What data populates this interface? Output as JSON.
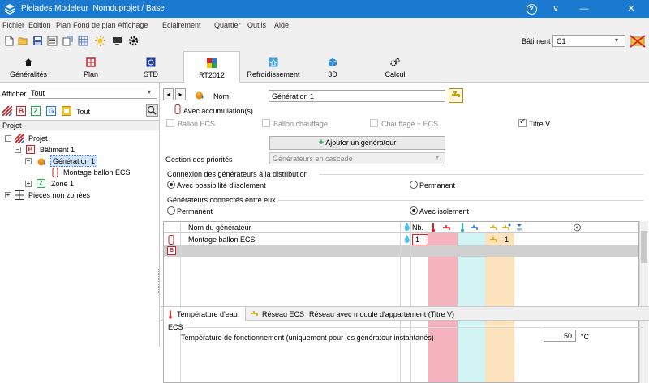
{
  "titlebar": {
    "app_name": "Pleiades Modeleur",
    "project_path": "Nomduprojet / Base",
    "help_glyph": "?",
    "chevron_glyph": "∨",
    "minimize_glyph": "—",
    "close_glyph": "✕"
  },
  "menu": [
    "Fichier",
    "Edition",
    "Plan",
    "Fond de plan",
    "Affichage",
    "Eclairement",
    "Quartier",
    "Outils",
    "Aide"
  ],
  "toolbar": {
    "icons": [
      "new-icon",
      "open-icon",
      "save-icon",
      "list-icon",
      "export-icon",
      "grid-icon",
      "sun-icon",
      "monitor-icon",
      "gear-icon"
    ],
    "batiment_label": "Bâtiment",
    "batiment_value": "C1"
  },
  "tabs": [
    {
      "label": "Généralités",
      "icon": "home-icon"
    },
    {
      "label": "Plan",
      "icon": "plan-icon"
    },
    {
      "label": "STD",
      "icon": "std-icon"
    },
    {
      "label": "RT2012",
      "icon": "rt2012-icon"
    },
    {
      "label": "Refroidissement",
      "icon": "refroidissement-icon"
    },
    {
      "label": "3D",
      "icon": "cube-icon"
    },
    {
      "label": "Calcul",
      "icon": "calcul-icon"
    }
  ],
  "left": {
    "afficher_label": "Afficher",
    "afficher_value": "Tout",
    "filters": [
      "B",
      "Z",
      "G"
    ],
    "filter_tout": "Tout",
    "projet_header": "Projet",
    "tree": [
      {
        "label": "Projet",
        "level": 0,
        "icon": "project-icon"
      },
      {
        "label": "Bâtiment 1",
        "level": 1,
        "icon": "building-icon"
      },
      {
        "label": "Génération 1",
        "level": 2,
        "icon": "generation-icon",
        "selected": true
      },
      {
        "label": "Montage ballon ECS",
        "level": 3,
        "icon": "ballon-icon"
      },
      {
        "label": "Zone 1",
        "level": 2,
        "icon": "zone-icon"
      },
      {
        "label": "Pièces non zonées",
        "level": 0,
        "icon": "rooms-icon"
      }
    ]
  },
  "main": {
    "nom_label": "Nom",
    "nom_value": "Génération 1",
    "accumulation_label": "Avec accumulation(s)",
    "checkboxes": [
      {
        "label": "Ballon ECS",
        "checked": false,
        "enabled": false
      },
      {
        "label": "Ballon chauffage",
        "checked": false,
        "enabled": false
      },
      {
        "label": "Chauffage + ECS",
        "checked": false,
        "enabled": false
      },
      {
        "label": "Titre V",
        "checked": true,
        "enabled": true
      }
    ],
    "add_generator_label": "Ajouter un générateur",
    "gestion_label": "Gestion des priorités",
    "gestion_value": "Générateurs en cascade",
    "connexion_title": "Connexion des générateurs à la distribution",
    "connexion_options": [
      {
        "label": "Avec possibilité d'isolement",
        "selected": true
      },
      {
        "label": "Permanent",
        "selected": false
      }
    ],
    "connectes_title": "Générateurs connectés entre eux",
    "connectes_options": [
      {
        "label": "Permanent",
        "selected": false
      },
      {
        "label": "Avec isolement",
        "selected": true
      }
    ],
    "grid": {
      "col_name": "Nom du générateur",
      "col_nb": "Nb.",
      "rows": [
        {
          "name": "Montage ballon ECS",
          "nb": "1",
          "extra": "1"
        }
      ]
    },
    "subtabs": [
      "Température d'eau",
      "Réseau ECS",
      "Réseau avec module d'appartement (Titre V)"
    ],
    "ecs_section": "ECS",
    "temp_label": "Température de fonctionnement (uniquement pour les générateur instantanés)",
    "temp_value": "50",
    "temp_unit": "°C"
  }
}
